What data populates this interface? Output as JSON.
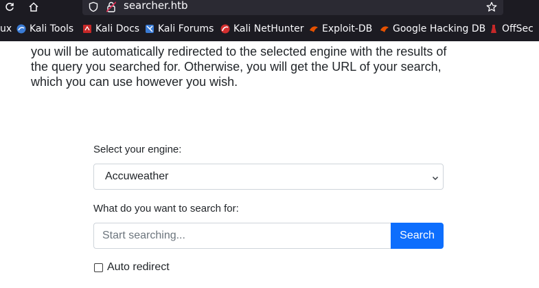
{
  "browser": {
    "url": "searcher.htb",
    "bookmarks": [
      {
        "label": "ux",
        "icon": "folder-icon"
      },
      {
        "label": "Kali Tools",
        "icon": "kali-tools-icon",
        "color": "#3a7bd5"
      },
      {
        "label": "Kali Docs",
        "icon": "kali-docs-icon",
        "color": "#c62828"
      },
      {
        "label": "Kali Forums",
        "icon": "kali-forums-icon",
        "color": "#3a7bd5"
      },
      {
        "label": "Kali NetHunter",
        "icon": "kali-nethunter-icon",
        "color": "#d32f2f"
      },
      {
        "label": "Exploit-DB",
        "icon": "exploit-db-icon",
        "color": "#e65100"
      },
      {
        "label": "Google Hacking DB",
        "icon": "ghdb-icon",
        "color": "#e65100"
      },
      {
        "label": "OffSec",
        "icon": "offsec-icon",
        "color": "#c62828"
      }
    ]
  },
  "intro": {
    "lines": [
      "you will be automatically redirected to the selected engine with the results of",
      "the query you searched for. Otherwise, you will get the URL of your search,",
      "which you can use however you wish."
    ]
  },
  "form": {
    "engine_label": "Select your engine:",
    "engine_selected": "Accuweather",
    "query_label": "What do you want to search for:",
    "query_placeholder": "Start searching...",
    "search_button": "Search",
    "auto_redirect_label": "Auto redirect",
    "auto_redirect_checked": false,
    "accent_color": "#0d6efd"
  }
}
